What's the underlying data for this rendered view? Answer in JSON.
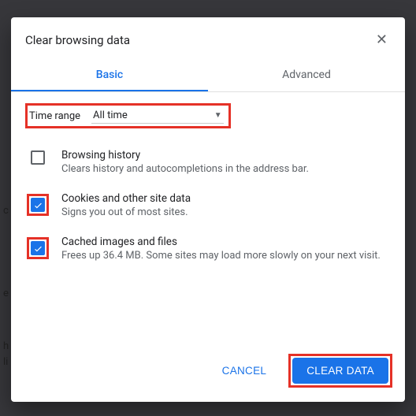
{
  "dialog": {
    "title": "Clear browsing data",
    "close_label": "Close"
  },
  "tabs": {
    "basic": "Basic",
    "advanced": "Advanced",
    "active": "basic"
  },
  "time_range": {
    "label": "Time range",
    "value": "All time"
  },
  "options": [
    {
      "title": "Browsing history",
      "desc": "Clears history and autocompletions in the address bar.",
      "checked": false,
      "highlighted": false
    },
    {
      "title": "Cookies and other site data",
      "desc": "Signs you out of most sites.",
      "checked": true,
      "highlighted": true
    },
    {
      "title": "Cached images and files",
      "desc": "Frees up 36.4 MB. Some sites may load more slowly on your next visit.",
      "checked": true,
      "highlighted": true
    }
  ],
  "buttons": {
    "cancel": "CANCEL",
    "confirm": "CLEAR DATA"
  },
  "highlights": {
    "time_range": true,
    "confirm_button": true
  },
  "colors": {
    "accent": "#1a73e8",
    "highlight": "#e53127"
  }
}
